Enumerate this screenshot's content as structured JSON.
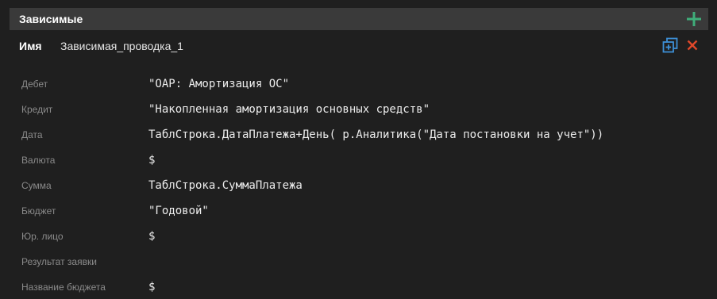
{
  "section": {
    "title": "Зависимые",
    "add_icon": "plus-icon",
    "add_color": "#3fae7a"
  },
  "entry": {
    "name_label": "Имя",
    "name_value": "Зависимая_проводка_1",
    "copy_icon": "duplicate-icon",
    "copy_color": "#3d8fd6",
    "delete_icon": "close-icon",
    "delete_color": "#e0482a"
  },
  "fields": [
    {
      "label": "Дебет",
      "value": "\"ОАР: Амортизация ОС\""
    },
    {
      "label": "Кредит",
      "value": "\"Накопленная амортизация основных средств\""
    },
    {
      "label": "Дата",
      "value": "ТаблСтрока.ДатаПлатежа+День( р.Аналитика(\"Дата постановки на учет\"))"
    },
    {
      "label": "Валюта",
      "value": "$"
    },
    {
      "label": "Сумма",
      "value": "ТаблСтрока.СуммаПлатежа"
    },
    {
      "label": "Бюджет",
      "value": "\"Годовой\""
    },
    {
      "label": "Юр. лицо",
      "value": "$"
    },
    {
      "label": "Результат заявки",
      "value": ""
    },
    {
      "label": "Название бюджета",
      "value": "$"
    }
  ]
}
